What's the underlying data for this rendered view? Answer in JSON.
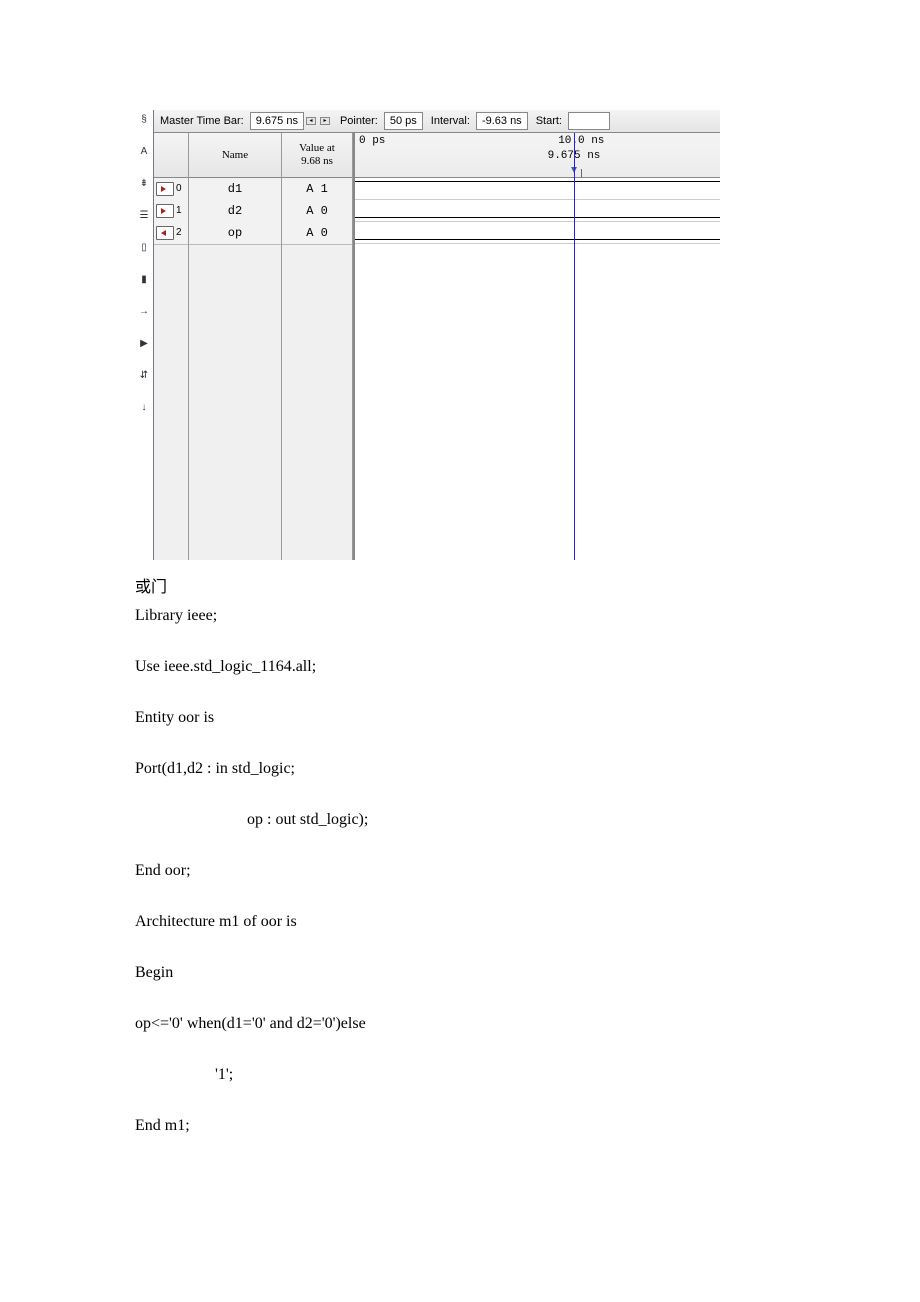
{
  "topbar": {
    "mtb_label": "Master Time Bar:",
    "mtb_val": "9.675 ns",
    "pointer_label": "Pointer:",
    "pointer_val": "50 ps",
    "interval_label": "Interval:",
    "interval_val": "-9.63 ns",
    "start_label": "Start:"
  },
  "headers": {
    "name": "Name",
    "value": "Value at\n9.68 ns"
  },
  "signals": [
    {
      "idx": "0",
      "dir": "in",
      "name": "d1",
      "val": "A 1",
      "level": "high"
    },
    {
      "idx": "1",
      "dir": "in",
      "name": "d2",
      "val": "A 0",
      "level": "low"
    },
    {
      "idx": "2",
      "dir": "out",
      "name": "op",
      "val": "A 0",
      "level": "low"
    }
  ],
  "ruler": {
    "left_zero": "0 ps",
    "tick_time": "10.0 ns",
    "marker_time": "9.675 ns",
    "tick_percent": 62,
    "marker_percent": 60
  },
  "doc": {
    "l0": "或门",
    "l1": "Library ieee;",
    "l2": "Use ieee.std_logic_1164.all;",
    "l3": "Entity oor is",
    "l4": "Port(d1,d2 : in std_logic;",
    "l5": "op : out std_logic);",
    "l6": "End oor;",
    "l7": "Architecture m1 of oor is",
    "l8": "Begin",
    "l9": "op<='0' when(d1='0' and d2='0')else",
    "l10": "'1';",
    "l11": "End m1;"
  }
}
